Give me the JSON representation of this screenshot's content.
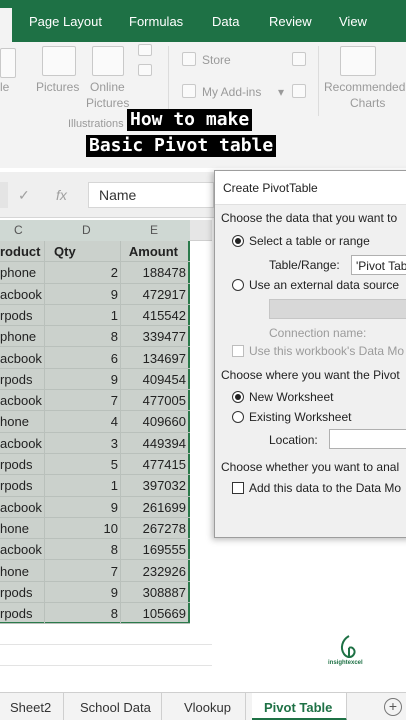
{
  "ribbon_tabs": [
    "Page Layout",
    "Formulas",
    "Data",
    "Review",
    "View"
  ],
  "ribbon": {
    "pictures": "Pictures",
    "online_pictures_1": "Online",
    "online_pictures_2": "Pictures",
    "illustrations": "Illustrations",
    "store": "Store",
    "my_addins": "My Add-ins",
    "recommended_1": "Recommended",
    "recommended_2": "Charts"
  },
  "caption": {
    "line1": "How to make",
    "line2": "Basic Pivot table"
  },
  "formula_bar": {
    "cancel_symbol": "✓",
    "fx_symbol": "fx",
    "value": "Name"
  },
  "columns": [
    "C",
    "D",
    "E"
  ],
  "table": {
    "headers": [
      "roduct",
      "Qty",
      "Amount"
    ],
    "rows": [
      [
        "phone",
        "2",
        "188478"
      ],
      [
        "acbook",
        "9",
        "472917"
      ],
      [
        "rpods",
        "1",
        "415542"
      ],
      [
        "phone",
        "8",
        "339477"
      ],
      [
        "acbook",
        "6",
        "134697"
      ],
      [
        "rpods",
        "9",
        "409454"
      ],
      [
        "acbook",
        "7",
        "477005"
      ],
      [
        "hone",
        "4",
        "409660"
      ],
      [
        "acbook",
        "3",
        "449394"
      ],
      [
        "rpods",
        "5",
        "477415"
      ],
      [
        "rpods",
        "1",
        "397032"
      ],
      [
        "acbook",
        "9",
        "261699"
      ],
      [
        "hone",
        "10",
        "267278"
      ],
      [
        "acbook",
        "8",
        "169555"
      ],
      [
        "hone",
        "7",
        "232926"
      ],
      [
        "rpods",
        "9",
        "308887"
      ],
      [
        "rpods",
        "8",
        "105669"
      ]
    ]
  },
  "dialog": {
    "title": "Create PivotTable",
    "choose_data": "Choose the data that you want to",
    "select_table": "Select a table or range",
    "table_range_label": "Table/Range:",
    "table_range_value": "'Pivot Tab",
    "use_external": "Use an external data source",
    "connection_name": "Connection name:",
    "use_workbook": "Use this workbook's Data Mo",
    "choose_where": "Choose where you want the Pivot",
    "new_worksheet": "New Worksheet",
    "existing_worksheet": "Existing Worksheet",
    "location_label": "Location:",
    "choose_analyze": "Choose whether you want to anal",
    "add_data_model": "Add this data to the Data Mo"
  },
  "sheet_tabs": [
    "Sheet2",
    "School Data",
    "Vlookup",
    "Pivot Table"
  ],
  "active_sheet": "Pivot Table",
  "logo_text": "insightexcel",
  "colors": {
    "excel_green": "#1e7145",
    "selection_fill": "#cbd1cc"
  }
}
